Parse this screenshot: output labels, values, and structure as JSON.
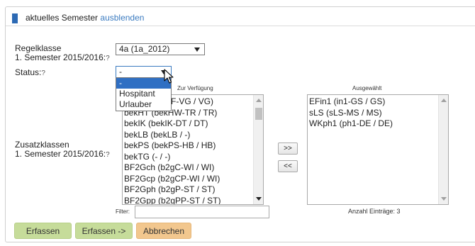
{
  "header": {
    "title": "aktuelles Semester",
    "hide_link": "ausblenden"
  },
  "regelklasse": {
    "label": "Regelklasse",
    "semester_label": "1. Semester 2015/2016:",
    "help": "?",
    "value": "4a (1a_2012)"
  },
  "status": {
    "label": "Status:",
    "help": "?",
    "value": "-",
    "options": [
      "-",
      "Hospitant",
      "Urlauber"
    ]
  },
  "zusatzklassen": {
    "label": "Zusatzklassen",
    "semester_label": "1. Semester 2015/2016:",
    "help": "?"
  },
  "available": {
    "heading": "Zur Verfügung",
    "items": [
      "bekIA (bekGF-VG / VG)",
      "bekHT (bekHW-TR / TR)",
      "bekIK (bekIK-DT / DT)",
      "bekLB (bekLB / -)",
      "bekPS (bekPS-HB / HB)",
      "bekTG (- / -)",
      "BF2Gch (b2gC-WI / WI)",
      "BF2Gcp (b2gCP-WI / WI)",
      "BF2Gph (b2gP-ST / ST)",
      "BF2Gpp (b2gPP-ST / ST)"
    ],
    "filter_label": "Filter:",
    "filter_value": ""
  },
  "move": {
    "add_label": ">>",
    "remove_label": "<<"
  },
  "selected": {
    "heading": "Ausgewählt",
    "items": [
      "EFin1 (in1-GS / GS)",
      "sLS (sLS-MS / MS)",
      "WKph1 (ph1-DE / DE)"
    ],
    "count_label": "Anzahl Einträge: 3"
  },
  "actions": {
    "save": "Erfassen",
    "save_next": "Erfassen ->",
    "cancel": "Abbrechen"
  },
  "colors": {
    "accent": "#2d6ab4",
    "link": "#3b7bc0",
    "selected_option": "#2f6fc3",
    "button_green": "#c6dc9a",
    "button_orange": "#f2c78e"
  }
}
